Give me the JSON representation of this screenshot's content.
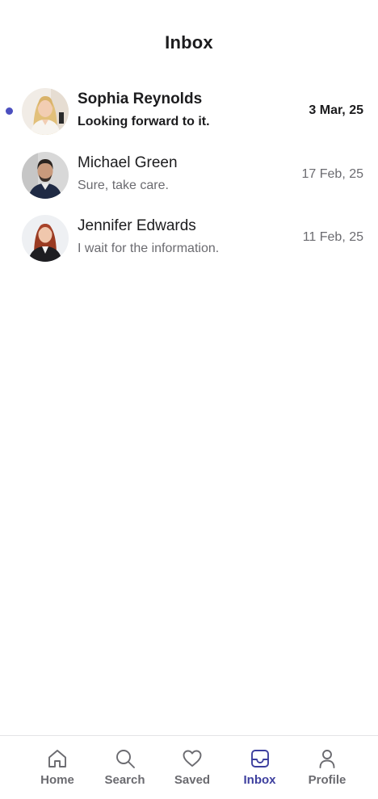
{
  "header": {
    "title": "Inbox"
  },
  "conversations": [
    {
      "name": "Sophia Reynolds",
      "message": "Looking forward to it.",
      "date": "3 Mar, 25",
      "unread": true
    },
    {
      "name": "Michael Green",
      "message": "Sure, take care.",
      "date": "17 Feb, 25",
      "unread": false
    },
    {
      "name": "Jennifer Edwards",
      "message": "I wait for the information.",
      "date": "11 Feb, 25",
      "unread": false
    }
  ],
  "tab_bar": {
    "items": [
      {
        "label": "Home",
        "icon": "home-icon"
      },
      {
        "label": "Search",
        "icon": "search-icon"
      },
      {
        "label": "Saved",
        "icon": "heart-icon"
      },
      {
        "label": "Inbox",
        "icon": "inbox-icon"
      },
      {
        "label": "Profile",
        "icon": "user-icon"
      }
    ],
    "active": "Inbox"
  },
  "colors": {
    "accent": "#3d3f9e",
    "unread_dot": "#4b4fbf",
    "muted_text": "#6b6b70",
    "primary_text": "#1c1c1e"
  }
}
